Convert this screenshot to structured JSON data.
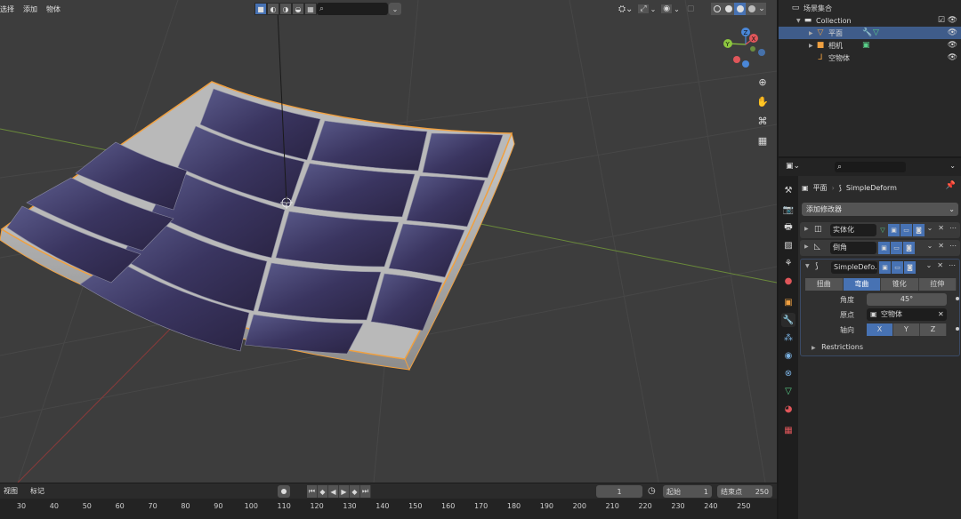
{
  "viewport": {
    "menu": [
      "选择",
      "添加",
      "物体"
    ],
    "search_placeholder": "⌕"
  },
  "timeline": {
    "menu": [
      "视图",
      "标记"
    ],
    "current_frame": "1",
    "start_label": "起始",
    "start_value": "1",
    "end_label": "结束点",
    "end_value": "250",
    "ticks": [
      "30",
      "40",
      "50",
      "60",
      "70",
      "80",
      "90",
      "100",
      "110",
      "120",
      "130",
      "140",
      "150",
      "160",
      "170",
      "180",
      "190",
      "200",
      "210",
      "220",
      "230",
      "240",
      "250"
    ]
  },
  "outliner": {
    "title": "场景集合",
    "collection": "Collection",
    "items": [
      {
        "label": "平面",
        "selected": true
      },
      {
        "label": "相机",
        "selected": false
      },
      {
        "label": "空物体",
        "selected": false
      }
    ]
  },
  "properties": {
    "search_placeholder": "⌕",
    "breadcrumb_object": "平面",
    "breadcrumb_modifier": "SimpleDeform",
    "add_modifier": "添加修改器",
    "modifiers": [
      {
        "name": "实体化"
      },
      {
        "name": "倒角"
      },
      {
        "name": "SimpleDefo..."
      }
    ],
    "deform_modes": [
      "扭曲",
      "弯曲",
      "锥化",
      "拉伸"
    ],
    "active_mode": "弯曲",
    "angle_label": "角度",
    "angle_value": "45°",
    "origin_label": "原点",
    "origin_value": "空物体",
    "axis_label": "轴向",
    "axes": [
      "X",
      "Y",
      "Z"
    ],
    "active_axis": "X",
    "restrictions": "Restrictions"
  },
  "colors": {
    "accent": "#4772b3",
    "selection_outline": "#f0a040",
    "x_axis": "#e0565a",
    "y_axis": "#8cc63f",
    "z_axis": "#4a87d8"
  }
}
